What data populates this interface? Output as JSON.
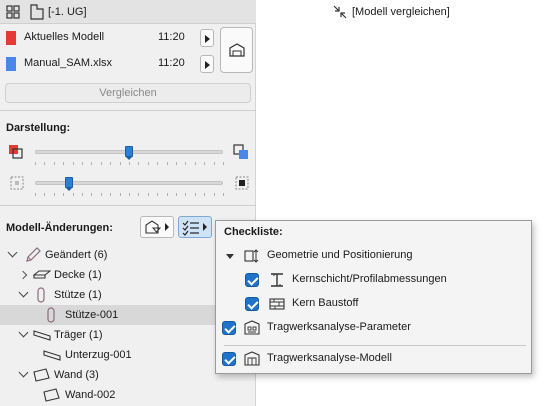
{
  "header": {
    "floor_label": "[-1. UG]",
    "view_tab_label": "[Modell vergleichen]"
  },
  "sources": [
    {
      "name": "Aktuelles Modell",
      "time": "11:20",
      "color": "#e53935"
    },
    {
      "name": "Manual_SAM.xlsx",
      "time": "11:20",
      "color": "#4a86e8"
    }
  ],
  "compare_button_label": "Vergleichen",
  "darstellung": {
    "label": "Darstellung:",
    "slider1_value": 0.5,
    "slider2_value": 0.18
  },
  "changes": {
    "label": "Modell-Änderungen:",
    "tree": [
      {
        "label": "Geändert (6)",
        "icon": "pencil-icon",
        "level": 0,
        "expanded": true
      },
      {
        "label": "Decke (1)",
        "icon": "slab-icon",
        "level": 1,
        "expanded": false
      },
      {
        "label": "Stütze (1)",
        "icon": "column-icon",
        "level": 1,
        "expanded": true
      },
      {
        "label": "Stütze-001",
        "icon": "column-icon",
        "level": 2,
        "selected": true
      },
      {
        "label": "Träger (1)",
        "icon": "beam-icon",
        "level": 1,
        "expanded": true
      },
      {
        "label": "Unterzug-001",
        "icon": "beam-icon",
        "level": 2
      },
      {
        "label": "Wand (3)",
        "icon": "wall-icon",
        "level": 1,
        "expanded": true
      },
      {
        "label": "Wand-002",
        "icon": "wall-icon",
        "level": 2
      }
    ]
  },
  "checklist": {
    "title": "Checkliste:",
    "items": [
      {
        "label": "Geometrie und Positionierung",
        "icon": "geometry-icon",
        "group": true,
        "checked": null
      },
      {
        "label": "Kernschicht/Profilabmessungen",
        "icon": "profile-icon",
        "checked": true
      },
      {
        "label": "Kern Baustoff",
        "icon": "material-icon",
        "checked": true
      },
      {
        "label": "Tragwerksanalyse-Parameter",
        "icon": "analysis-params-icon",
        "checked": true
      },
      {
        "label": "Tragwerksanalyse-Modell",
        "icon": "analysis-model-icon",
        "checked": true
      }
    ]
  },
  "colors": {
    "accent": "#1f73c9",
    "selection": "#d8d8d8"
  }
}
